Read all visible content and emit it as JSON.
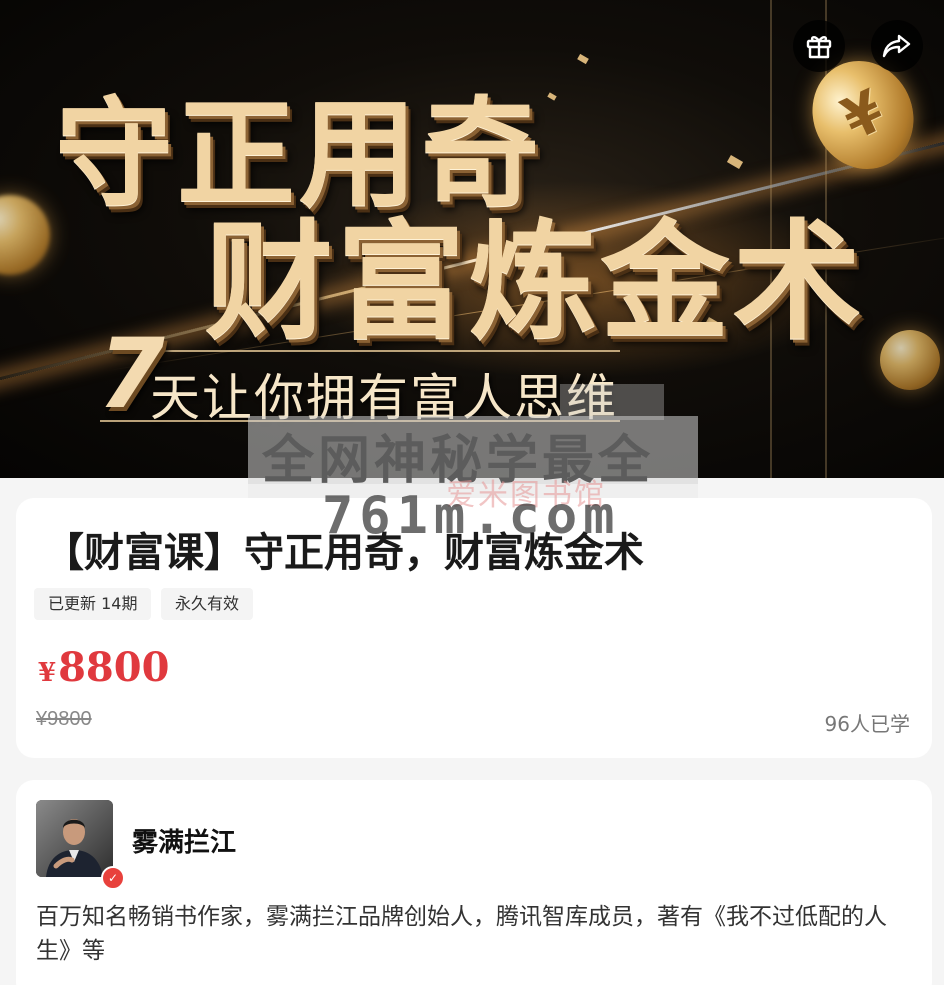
{
  "banner": {
    "headline_line1": "守正用奇",
    "headline_line2": "财富炼金术",
    "number": "7",
    "slogan": "天让你拥有富人思维"
  },
  "watermark": {
    "line1": "全网神秘学最全",
    "line2": "761m.com",
    "line3": "爱米图书馆"
  },
  "actions": {
    "gift_icon": "gift-icon",
    "share_icon": "share-icon"
  },
  "course": {
    "title": "【财富课】守正用奇，财富炼金术",
    "tags": [
      "已更新 14期",
      "永久有效"
    ],
    "currency": "¥",
    "price": "8800",
    "original_price": "¥9800",
    "learners": "96人已学",
    "price_color": "#e0393e"
  },
  "author": {
    "name": "雾满拦江",
    "verified_icon": "verified-badge-icon",
    "bio": "百万知名畅销书作家，雾满拦江品牌创始人，腾讯智库成员，著有《我不过低配的人生》等"
  }
}
